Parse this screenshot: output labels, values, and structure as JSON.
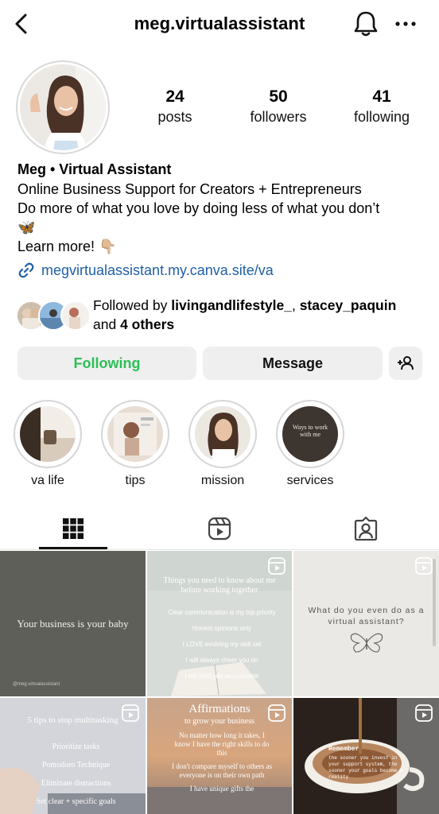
{
  "header": {
    "username": "meg.virtualassistant",
    "icons": [
      "back-arrow-icon",
      "bell-icon",
      "more-icon"
    ]
  },
  "stats": [
    {
      "count": "24",
      "label": "posts"
    },
    {
      "count": "50",
      "label": "followers"
    },
    {
      "count": "41",
      "label": "following"
    }
  ],
  "bio": {
    "name": "Meg • Virtual Assistant",
    "line1": "Online Business Support for Creators + Entrepreneurs",
    "line2": "Do more of what you love by doing less of what you don’t",
    "line3_emoji": "🦋",
    "line4": "Learn more! 👇🏼",
    "link": "megvirtualassistant.my.canva.site/va"
  },
  "followed_by": {
    "prefix": "Followed by ",
    "user1": "livingandlifestyle_",
    "sep": ", ",
    "user2": "stacey_paquin",
    "and": "and ",
    "others": "4 others"
  },
  "buttons": {
    "following": "Following",
    "message": "Message"
  },
  "highlights": [
    {
      "label": "va life"
    },
    {
      "label": "tips"
    },
    {
      "label": "mission"
    },
    {
      "label": "services"
    }
  ],
  "services_thumb_text": "Ways to work with me",
  "posts": {
    "p1": {
      "text": "Your business is your baby",
      "handle": "@meg.virtualassistant"
    },
    "p2": {
      "title": "Things you need to know about me before working together",
      "items": [
        "Clear communication is my top priority",
        "Honest opinions only",
        "I LOVE evolving my skill set",
        "I will always cheer you on",
        "I will hold you accountable"
      ]
    },
    "p3": {
      "text": "What do you even do as a virtual assistant?"
    },
    "p4": {
      "title": "5 tips to stop multitasking",
      "items": [
        "Prioritize tasks",
        "Pomodoro Technique",
        "Eliminate distractions",
        "Set clear + specific goals"
      ]
    },
    "p5": {
      "title": "Affirmations",
      "subtitle": "to grow your business",
      "items": [
        "No matter how long it takes, I know I have the right skills to do this",
        "I don't compare myself to others as everyone is on their own path",
        "I have unique gifts the"
      ]
    },
    "p6": {
      "title": "Remember",
      "body": "the sooner you invest in your support system, the sooner your goals become a reality"
    }
  }
}
